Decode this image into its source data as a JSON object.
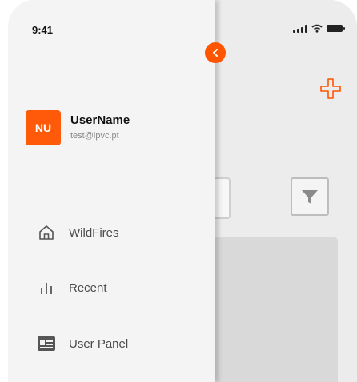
{
  "status_bar": {
    "time": "9:41"
  },
  "profile": {
    "initials": "NU",
    "name": "UserName",
    "email": "test@ipvc.pt"
  },
  "nav": {
    "items": [
      {
        "label": "WildFires",
        "icon": "home-icon"
      },
      {
        "label": "Recent",
        "icon": "bar-chart-icon"
      },
      {
        "label": "User Panel",
        "icon": "id-card-icon"
      }
    ]
  },
  "colors": {
    "accent": "#ff5500",
    "drawer_bg": "#f4f4f4",
    "app_bg": "#ececec"
  }
}
